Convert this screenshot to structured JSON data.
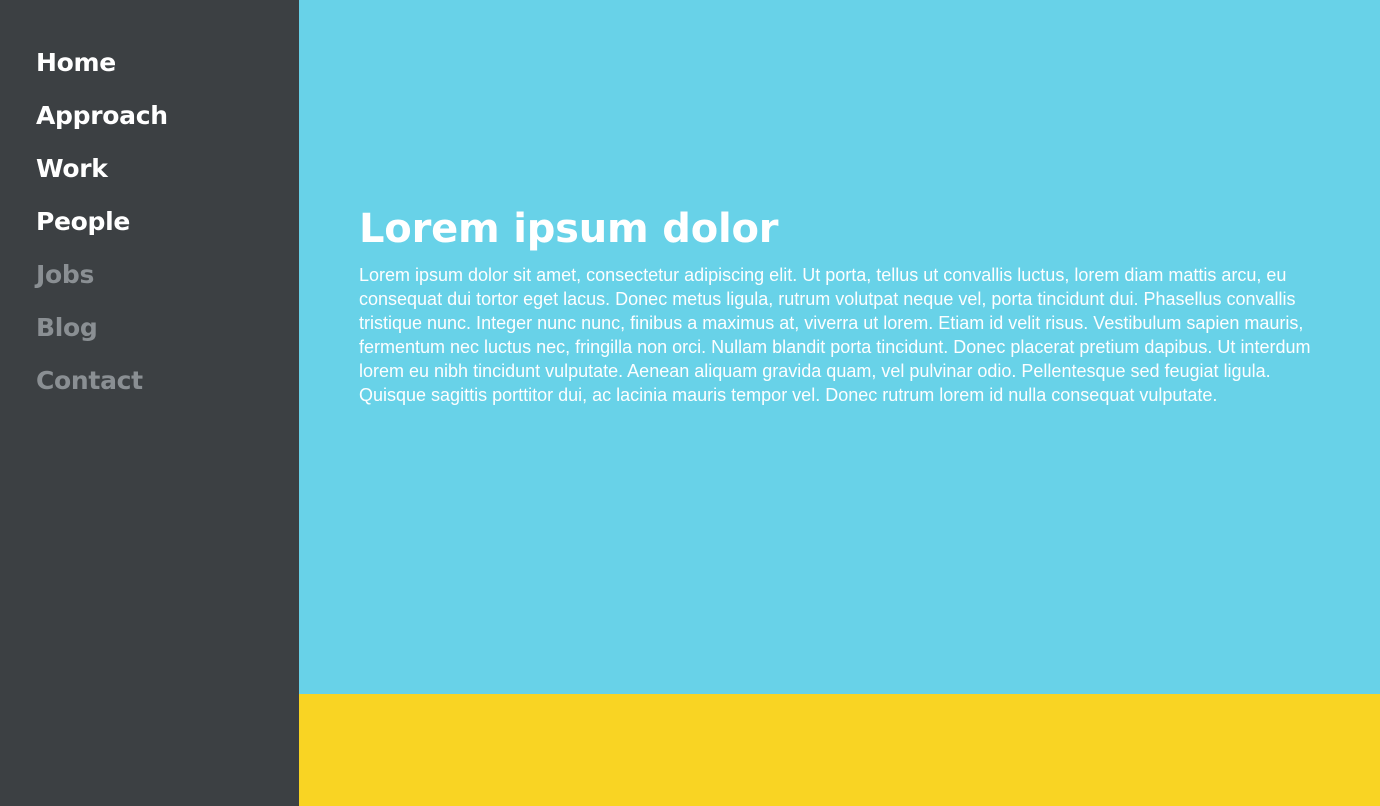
{
  "theme": {
    "sidebar_bg": "#3c4043",
    "hero_bg": "#68d2e8",
    "footer_bg": "#f9d423",
    "nav_active_color": "#ffffff",
    "nav_muted_color": "#8a8f93",
    "heading_color": "#ffffff",
    "body_color": "#fdfeff"
  },
  "sidebar": {
    "items": [
      {
        "label": "Home",
        "state": "active"
      },
      {
        "label": "Approach",
        "state": "active"
      },
      {
        "label": "Work",
        "state": "active"
      },
      {
        "label": "People",
        "state": "active"
      },
      {
        "label": "Jobs",
        "state": "muted"
      },
      {
        "label": "Blog",
        "state": "muted"
      },
      {
        "label": "Contact",
        "state": "muted"
      }
    ]
  },
  "hero": {
    "title": "Lorem ipsum dolor",
    "body": "Lorem ipsum dolor sit amet, consectetur adipiscing elit. Ut porta, tellus ut convallis luctus, lorem diam mattis arcu, eu consequat dui tortor eget lacus. Donec metus ligula, rutrum volutpat neque vel, porta tincidunt dui. Phasellus convallis tristique nunc. Integer nunc nunc, finibus a maximus at, viverra ut lorem. Etiam id velit risus. Vestibulum sapien mauris, fermentum nec luctus nec, fringilla non orci. Nullam blandit porta tincidunt. Donec placerat pretium dapibus. Ut interdum lorem eu nibh tincidunt vulputate. Aenean aliquam gravida quam, vel pulvinar odio. Pellentesque sed feugiat ligula. Quisque sagittis porttitor dui, ac lacinia mauris tempor vel. Donec rutrum lorem id nulla consequat vulputate."
  }
}
